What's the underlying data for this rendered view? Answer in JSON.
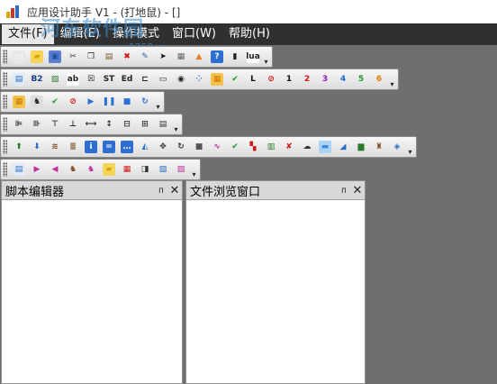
{
  "window": {
    "title": "应用设计助手 V1 - (打地鼠) - []"
  },
  "watermark": {
    "text": "河东软件园",
    "sub": "www.pc0359.cn"
  },
  "menu": [
    {
      "label": "文件(F)"
    },
    {
      "label": "编辑(E)"
    },
    {
      "label": "操作模式"
    },
    {
      "label": "窗口(W)"
    },
    {
      "label": "帮助(H)"
    }
  ],
  "toolbars": {
    "row1": [
      {
        "name": "new-file-icon",
        "glyph": "▭",
        "color": "#ffffff",
        "bg": "#e8e8e8"
      },
      {
        "name": "open-folder-icon",
        "glyph": "▰",
        "color": "#d9a300",
        "bg": "#f5d45a"
      },
      {
        "name": "save-icon",
        "glyph": "▣",
        "color": "#1d4fa3",
        "bg": "#5b7fd0"
      },
      {
        "name": "cut-icon",
        "glyph": "✂",
        "color": "#333",
        "bg": "transparent"
      },
      {
        "name": "copy-icon",
        "glyph": "❐",
        "color": "#333",
        "bg": "transparent"
      },
      {
        "name": "paste-icon",
        "glyph": "▤",
        "color": "#7a5a2a",
        "bg": "transparent"
      },
      {
        "name": "delete-icon",
        "glyph": "✖",
        "color": "#d21010",
        "bg": "transparent"
      },
      {
        "name": "edit-icon",
        "glyph": "✎",
        "color": "#2f5fa5",
        "bg": "transparent"
      },
      {
        "name": "pointer-icon",
        "glyph": "➤",
        "color": "#111",
        "bg": "transparent"
      },
      {
        "name": "grid-icon",
        "glyph": "▦",
        "color": "#666",
        "bg": "transparent"
      },
      {
        "name": "shapes-icon",
        "glyph": "▲",
        "color": "#e67e22",
        "bg": "transparent"
      },
      {
        "name": "help-icon",
        "glyph": "?",
        "color": "#fff",
        "bg": "#2c6fd1"
      },
      {
        "name": "phone-icon",
        "glyph": "▮",
        "color": "#222",
        "bg": "transparent"
      },
      {
        "name": "lua-icon",
        "glyph": "lua",
        "color": "#222",
        "bg": "#ffffff"
      }
    ],
    "row2": [
      {
        "name": "form-icon",
        "glyph": "▤",
        "color": "#2b6cc4",
        "bg": "#dfe9f7"
      },
      {
        "name": "b2-icon",
        "glyph": "B2",
        "color": "#1a3c8c",
        "bg": "transparent"
      },
      {
        "name": "image-icon",
        "glyph": "▨",
        "color": "#2b7a2b",
        "bg": "transparent"
      },
      {
        "name": "ab-label-icon",
        "glyph": "ab",
        "color": "#222",
        "bg": "#ffffff"
      },
      {
        "name": "checkbox-icon",
        "glyph": "☒",
        "color": "#222",
        "bg": "transparent"
      },
      {
        "name": "st-icon",
        "glyph": "ST",
        "color": "#222",
        "bg": "transparent"
      },
      {
        "name": "ed-icon",
        "glyph": "Ed",
        "color": "#222",
        "bg": "transparent"
      },
      {
        "name": "slider-icon",
        "glyph": "⊏",
        "color": "#222",
        "bg": "transparent"
      },
      {
        "name": "button-control-icon",
        "glyph": "▭",
        "color": "#222",
        "bg": "transparent"
      },
      {
        "name": "radio-icon",
        "glyph": "◉",
        "color": "#222",
        "bg": "transparent"
      },
      {
        "name": "dots-icon",
        "glyph": "⁘",
        "color": "#2b6cc4",
        "bg": "transparent"
      },
      {
        "name": "table-color-icon",
        "glyph": "▦",
        "color": "#d07a00",
        "bg": "#f3c24a"
      },
      {
        "name": "check-icon",
        "glyph": "✔",
        "color": "#1b9a2a",
        "bg": "transparent"
      },
      {
        "name": "l-icon",
        "glyph": "L",
        "color": "#111",
        "bg": "transparent"
      },
      {
        "name": "no-icon",
        "glyph": "⊘",
        "color": "#d41515",
        "bg": "transparent"
      },
      {
        "name": "num1-icon",
        "glyph": "1",
        "color": "#111",
        "bg": "transparent"
      },
      {
        "name": "num2-icon",
        "glyph": "2",
        "color": "#d41515",
        "bg": "transparent"
      },
      {
        "name": "num3-icon",
        "glyph": "3",
        "color": "#8b1ab0",
        "bg": "transparent"
      },
      {
        "name": "num4-icon",
        "glyph": "4",
        "color": "#1a6bd0",
        "bg": "transparent"
      },
      {
        "name": "num5-icon",
        "glyph": "5",
        "color": "#1b9a2a",
        "bg": "transparent"
      },
      {
        "name": "num6-icon",
        "glyph": "6",
        "color": "#e07b00",
        "bg": "transparent"
      }
    ],
    "row3": [
      {
        "name": "grid-color-icon",
        "glyph": "▦",
        "color": "#d07a00",
        "bg": "#f3c24a"
      },
      {
        "name": "character-icon",
        "glyph": "♞",
        "color": "#222",
        "bg": "#dddddd"
      },
      {
        "name": "check-green-icon",
        "glyph": "✔",
        "color": "#1b9a2a",
        "bg": "transparent"
      },
      {
        "name": "forbid-icon",
        "glyph": "⊘",
        "color": "#d41515",
        "bg": "transparent"
      },
      {
        "name": "play-icon",
        "glyph": "▶",
        "color": "#2a6ed8",
        "bg": "transparent"
      },
      {
        "name": "pause-icon",
        "glyph": "❚❚",
        "color": "#2a6ed8",
        "bg": "transparent"
      },
      {
        "name": "stop-icon",
        "glyph": "■",
        "color": "#2a6ed8",
        "bg": "transparent"
      },
      {
        "name": "loop-icon",
        "glyph": "↻",
        "color": "#2a6ed8",
        "bg": "transparent"
      }
    ],
    "row4": [
      {
        "name": "align-left-icon",
        "glyph": "⊫",
        "color": "#333",
        "bg": "transparent"
      },
      {
        "name": "align-right-icon",
        "glyph": "⊪",
        "color": "#333",
        "bg": "transparent"
      },
      {
        "name": "align-top-icon",
        "glyph": "⊤",
        "color": "#333",
        "bg": "transparent"
      },
      {
        "name": "align-bottom-icon",
        "glyph": "⊥",
        "color": "#333",
        "bg": "transparent"
      },
      {
        "name": "same-width-icon",
        "glyph": "⟷",
        "color": "#333",
        "bg": "transparent"
      },
      {
        "name": "same-height-icon",
        "glyph": "↕",
        "color": "#333",
        "bg": "transparent"
      },
      {
        "name": "distribute-h-icon",
        "glyph": "⊟",
        "color": "#333",
        "bg": "transparent"
      },
      {
        "name": "distribute-v-icon",
        "glyph": "⊞",
        "color": "#333",
        "bg": "transparent"
      },
      {
        "name": "layout-icon",
        "glyph": "▤",
        "color": "#333",
        "bg": "transparent"
      }
    ],
    "row5": [
      {
        "name": "layer-up-icon",
        "glyph": "⬆",
        "color": "#2b7a2b",
        "bg": "transparent"
      },
      {
        "name": "layer-down-icon",
        "glyph": "⬇",
        "color": "#2b6cc4",
        "bg": "transparent"
      },
      {
        "name": "stack-icon",
        "glyph": "≋",
        "color": "#7a4a1a",
        "bg": "transparent"
      },
      {
        "name": "stack2-icon",
        "glyph": "≣",
        "color": "#7a4a1a",
        "bg": "transparent"
      },
      {
        "name": "info-icon",
        "glyph": "i",
        "color": "#fff",
        "bg": "#2c6fd1"
      },
      {
        "name": "equal-icon",
        "glyph": "=",
        "color": "#fff",
        "bg": "#2c6fd1"
      },
      {
        "name": "more-icon",
        "glyph": "…",
        "color": "#fff",
        "bg": "#2c6fd1"
      },
      {
        "name": "fill-icon",
        "glyph": "◭",
        "color": "#2b6cc4",
        "bg": "transparent"
      },
      {
        "name": "move-icon",
        "glyph": "✥",
        "color": "#333",
        "bg": "transparent"
      },
      {
        "name": "rotate-icon",
        "glyph": "↻",
        "color": "#333",
        "bg": "transparent"
      },
      {
        "name": "square-icon",
        "glyph": "■",
        "color": "#555",
        "bg": "transparent"
      },
      {
        "name": "curve-icon",
        "glyph": "∿",
        "color": "#c0309a",
        "bg": "transparent"
      },
      {
        "name": "check2-icon",
        "glyph": "✔",
        "color": "#1b9a2a",
        "bg": "transparent"
      },
      {
        "name": "palette-icon",
        "glyph": "▚",
        "color": "#d41515",
        "bg": "transparent"
      },
      {
        "name": "bars-icon",
        "glyph": "▥",
        "color": "#2b7a2b",
        "bg": "transparent"
      },
      {
        "name": "remove-icon",
        "glyph": "✘",
        "color": "#d41515",
        "bg": "transparent"
      },
      {
        "name": "cloud-icon",
        "glyph": "☁",
        "color": "#333",
        "bg": "transparent"
      },
      {
        "name": "sky-image-icon",
        "glyph": "▬",
        "color": "#3a8ad6",
        "bg": "#a9d2f5"
      },
      {
        "name": "gradient-icon",
        "glyph": "◢",
        "color": "#2b6cc4",
        "bg": "transparent"
      },
      {
        "name": "chart-icon",
        "glyph": "▆",
        "color": "#2b7a2b",
        "bg": "transparent"
      },
      {
        "name": "sprite-icon",
        "glyph": "♜",
        "color": "#7a4a1a",
        "bg": "transparent"
      },
      {
        "name": "diamond-icon",
        "glyph": "◈",
        "color": "#2b6cc4",
        "bg": "transparent"
      }
    ],
    "row6": [
      {
        "name": "add-scene-icon",
        "glyph": "▤",
        "color": "#2b6cc4",
        "bg": "#dfe9f7"
      },
      {
        "name": "scene-right-icon",
        "glyph": "▶",
        "color": "#c0309a",
        "bg": "transparent"
      },
      {
        "name": "scene-left-icon",
        "glyph": "◀",
        "color": "#c0309a",
        "bg": "transparent"
      },
      {
        "name": "sprite-add-icon",
        "glyph": "♞",
        "color": "#7a4a1a",
        "bg": "transparent"
      },
      {
        "name": "sprite-move-icon",
        "glyph": "♞",
        "color": "#c0309a",
        "bg": "transparent"
      },
      {
        "name": "folder-image-icon",
        "glyph": "▰",
        "color": "#d9a300",
        "bg": "#f5d45a"
      },
      {
        "name": "import-icon",
        "glyph": "▦",
        "color": "#d41515",
        "bg": "transparent"
      },
      {
        "name": "export-icon",
        "glyph": "◨",
        "color": "#333",
        "bg": "transparent"
      },
      {
        "name": "image-list-icon",
        "glyph": "▧",
        "color": "#2b6cc4",
        "bg": "transparent"
      },
      {
        "name": "image-edit-icon",
        "glyph": "▨",
        "color": "#c0309a",
        "bg": "transparent"
      }
    ]
  },
  "panels": {
    "script_editor": {
      "title": "脚本编辑器",
      "pin": "ᴨ",
      "close": "✕"
    },
    "file_browser": {
      "title": "文件浏览窗口",
      "pin": "ᴨ",
      "close": "✕"
    }
  },
  "colors": {
    "menubar_bg": "#303030",
    "workspace_bg": "#6f6f6f",
    "panel_header_bg": "#d8d8d8"
  }
}
